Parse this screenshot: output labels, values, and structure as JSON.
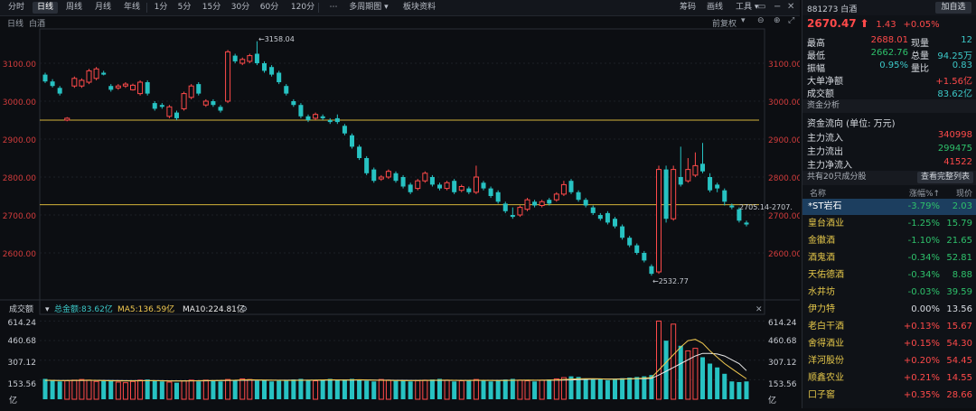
{
  "toolbar": {
    "items": [
      "分时",
      "日线",
      "周线",
      "月线",
      "年线",
      "1分",
      "5分",
      "15分",
      "30分",
      "60分",
      "120分",
      "多周期图",
      "板块资料"
    ],
    "right": [
      "筹码",
      "画线",
      "工具"
    ]
  },
  "subbar": {
    "period": "日线",
    "name": "白酒",
    "fq": "前复权"
  },
  "chart": {
    "price_axis": [
      "3100.00",
      "3000.00",
      "2900.00",
      "2800.00",
      "2700.00",
      "2600.00"
    ],
    "vol_axis": [
      "614.24",
      "460.68",
      "307.12",
      "153.56",
      "亿"
    ],
    "annot_high": "←3158.04",
    "annot_low": "←2532.77",
    "annot_line": "2705.14-2707.",
    "vol_legend": {
      "title": "成交额",
      "total": "总金额:83.62亿",
      "ma5": "MA5:136.59亿",
      "ma10": "MA10:224.81亿"
    },
    "colors": {
      "up": "#ff4a4a",
      "down": "#27c2c2",
      "ma5": "#f0c850",
      "ma10": "#e8e8e8",
      "hline": "#d4b43a"
    }
  },
  "chart_data": {
    "type": "candlestick",
    "y_range": [
      2505,
      3195
    ],
    "hlines": [
      2950,
      2727
    ],
    "candles": [
      [
        3070,
        3052,
        3075,
        3048
      ],
      [
        3052,
        3040,
        3058,
        3036
      ],
      [
        3035,
        3020,
        3040,
        3015
      ],
      [
        2950,
        2955,
        2958,
        2947
      ],
      [
        3040,
        3060,
        3065,
        3035
      ],
      [
        3040,
        3055,
        3060,
        3035
      ],
      [
        3050,
        3080,
        3085,
        3045
      ],
      [
        3060,
        3085,
        3090,
        3055
      ],
      [
        3075,
        3070,
        3080,
        3068
      ],
      [
        3040,
        3030,
        3045,
        3025
      ],
      [
        3035,
        3040,
        3045,
        3030
      ],
      [
        3040,
        3045,
        3050,
        3035
      ],
      [
        3030,
        3042,
        3046,
        3028
      ],
      [
        3020,
        3050,
        3055,
        3015
      ],
      [
        3050,
        3020,
        3055,
        3015
      ],
      [
        2995,
        2980,
        3000,
        2975
      ],
      [
        2990,
        2985,
        2995,
        2980
      ],
      [
        2960,
        2985,
        2990,
        2955
      ],
      [
        2970,
        2955,
        2975,
        2950
      ],
      [
        2980,
        3020,
        3025,
        2975
      ],
      [
        3010,
        3040,
        3045,
        3005
      ],
      [
        3045,
        3020,
        3050,
        3015
      ],
      [
        2990,
        3000,
        3005,
        2985
      ],
      [
        3000,
        2990,
        3005,
        2985
      ],
      [
        2985,
        2975,
        2990,
        2970
      ],
      [
        3000,
        3130,
        3135,
        2995
      ],
      [
        3120,
        3105,
        3125,
        3100
      ],
      [
        3100,
        3110,
        3115,
        3095
      ],
      [
        3105,
        3120,
        3125,
        3100
      ],
      [
        3125,
        3100,
        3158,
        3095
      ],
      [
        3100,
        3080,
        3105,
        3075
      ],
      [
        3090,
        3070,
        3095,
        3065
      ],
      [
        3075,
        3050,
        3080,
        3045
      ],
      [
        3040,
        3020,
        3045,
        3015
      ],
      [
        3000,
        2990,
        3005,
        2985
      ],
      [
        2990,
        2960,
        2995,
        2955
      ],
      [
        2960,
        2950,
        2965,
        2945
      ],
      [
        2955,
        2965,
        2970,
        2950
      ],
      [
        2960,
        2955,
        2965,
        2950
      ],
      [
        2950,
        2945,
        2955,
        2940
      ],
      [
        2955,
        2945,
        2965,
        2940
      ],
      [
        2935,
        2915,
        2940,
        2910
      ],
      [
        2910,
        2880,
        2915,
        2875
      ],
      [
        2880,
        2850,
        2885,
        2845
      ],
      [
        2850,
        2810,
        2855,
        2805
      ],
      [
        2820,
        2790,
        2825,
        2785
      ],
      [
        2795,
        2800,
        2805,
        2790
      ],
      [
        2800,
        2815,
        2820,
        2795
      ],
      [
        2810,
        2790,
        2815,
        2785
      ],
      [
        2800,
        2775,
        2805,
        2770
      ],
      [
        2780,
        2760,
        2785,
        2755
      ],
      [
        2770,
        2790,
        2795,
        2765
      ],
      [
        2790,
        2810,
        2815,
        2785
      ],
      [
        2800,
        2780,
        2805,
        2775
      ],
      [
        2780,
        2770,
        2785,
        2765
      ],
      [
        2770,
        2785,
        2790,
        2765
      ],
      [
        2790,
        2760,
        2795,
        2755
      ],
      [
        2765,
        2775,
        2780,
        2760
      ],
      [
        2770,
        2760,
        2775,
        2755
      ],
      [
        2760,
        2800,
        2830,
        2755
      ],
      [
        2785,
        2770,
        2790,
        2765
      ],
      [
        2770,
        2750,
        2775,
        2745
      ],
      [
        2760,
        2735,
        2765,
        2730
      ],
      [
        2730,
        2710,
        2735,
        2705
      ],
      [
        2700,
        2695,
        2720,
        2690
      ],
      [
        2700,
        2720,
        2725,
        2695
      ],
      [
        2715,
        2740,
        2745,
        2710
      ],
      [
        2735,
        2725,
        2740,
        2720
      ],
      [
        2725,
        2735,
        2740,
        2720
      ],
      [
        2740,
        2730,
        2745,
        2725
      ],
      [
        2740,
        2755,
        2760,
        2735
      ],
      [
        2755,
        2780,
        2790,
        2750
      ],
      [
        2790,
        2760,
        2795,
        2755
      ],
      [
        2760,
        2740,
        2765,
        2735
      ],
      [
        2740,
        2725,
        2745,
        2720
      ],
      [
        2720,
        2705,
        2725,
        2700
      ],
      [
        2700,
        2690,
        2705,
        2685
      ],
      [
        2705,
        2680,
        2710,
        2675
      ],
      [
        2690,
        2670,
        2695,
        2665
      ],
      [
        2670,
        2640,
        2675,
        2635
      ],
      [
        2640,
        2620,
        2645,
        2615
      ],
      [
        2620,
        2600,
        2625,
        2595
      ],
      [
        2600,
        2580,
        2605,
        2575
      ],
      [
        2565,
        2545,
        2570,
        2540
      ],
      [
        2550,
        2820,
        2830,
        2545
      ],
      [
        2820,
        2690,
        2830,
        2680
      ],
      [
        2690,
        2820,
        2830,
        2685
      ],
      [
        2800,
        2780,
        2880,
        2775
      ],
      [
        2790,
        2820,
        2850,
        2785
      ],
      [
        2805,
        2830,
        2865,
        2800
      ],
      [
        2835,
        2815,
        2890,
        2810
      ],
      [
        2800,
        2765,
        2810,
        2760
      ],
      [
        2780,
        2770,
        2785,
        2760
      ],
      [
        2765,
        2735,
        2770,
        2725
      ],
      [
        2725,
        2720,
        2730,
        2715
      ],
      [
        2715,
        2685,
        2720,
        2680
      ],
      [
        2680,
        2675,
        2685,
        2670
      ]
    ],
    "volume": {
      "series": [
        {
          "name": "成交额",
          "unit": "亿",
          "values": [
            160,
            150,
            140,
            145,
            150,
            155,
            150,
            140,
            145,
            150,
            135,
            130,
            140,
            150,
            155,
            145,
            140,
            135,
            130,
            145,
            150,
            140,
            150,
            145,
            140,
            155,
            150,
            160,
            155,
            145,
            150,
            140,
            145,
            150,
            155,
            160,
            150,
            145,
            150,
            160,
            150,
            155,
            160,
            150,
            145,
            140,
            155,
            150,
            145,
            150,
            140,
            145,
            150,
            155,
            160,
            150,
            140,
            145,
            150,
            155,
            145,
            140,
            150,
            155,
            160,
            150,
            145,
            140,
            150,
            155,
            160,
            170,
            180,
            175,
            160,
            155,
            160,
            150,
            155,
            165,
            170,
            175,
            180,
            190,
            614,
            460,
            590,
            420,
            380,
            400,
            330,
            280,
            250,
            200,
            140,
            135,
            140
          ]
        },
        {
          "name": "MA5",
          "values": [
            150,
            148,
            146,
            147,
            148,
            149,
            150,
            148,
            146,
            145,
            145,
            144,
            145,
            145,
            146,
            146,
            145,
            144,
            143,
            144,
            145,
            146,
            147,
            147,
            148,
            149,
            150,
            152,
            153,
            152,
            151,
            150,
            149,
            148,
            148,
            149,
            150,
            151,
            152,
            153,
            152,
            151,
            152,
            153,
            152,
            150,
            149,
            148,
            147,
            146,
            146,
            147,
            148,
            149,
            150,
            150,
            149,
            148,
            148,
            149,
            149,
            148,
            147,
            148,
            149,
            150,
            151,
            150,
            150,
            151,
            152,
            155,
            158,
            160,
            162,
            161,
            160,
            158,
            157,
            158,
            160,
            163,
            166,
            170,
            230,
            290,
            350,
            410,
            460,
            470,
            440,
            380,
            330,
            280,
            240,
            200,
            160
          ]
        },
        {
          "name": "MA10",
          "values": [
            148,
            148,
            147,
            147,
            147,
            147,
            148,
            148,
            148,
            147,
            147,
            146,
            146,
            146,
            146,
            146,
            146,
            145,
            145,
            145,
            145,
            145,
            145,
            146,
            146,
            147,
            148,
            149,
            150,
            150,
            150,
            150,
            150,
            150,
            150,
            150,
            150,
            150,
            150,
            151,
            151,
            151,
            151,
            151,
            151,
            151,
            150,
            150,
            149,
            149,
            148,
            148,
            148,
            148,
            148,
            148,
            148,
            148,
            148,
            148,
            148,
            148,
            148,
            148,
            149,
            149,
            149,
            149,
            149,
            150,
            150,
            151,
            152,
            154,
            156,
            158,
            159,
            159,
            159,
            160,
            160,
            161,
            162,
            164,
            190,
            220,
            250,
            280,
            310,
            340,
            360,
            360,
            355,
            340,
            310,
            280,
            225
          ]
        }
      ]
    }
  },
  "panel": {
    "code": "881273",
    "name": "白酒",
    "add": "加自选",
    "price": "2670.47",
    "arrow": "⬆",
    "change": "1.43",
    "pct": "+0.05%",
    "quotes": [
      {
        "l1": "最高",
        "v1": "2688.01",
        "c1": "red",
        "l2": "现量",
        "v2": "12",
        "c2": "cyan"
      },
      {
        "l1": "最低",
        "v1": "2662.76",
        "c1": "green",
        "l2": "总量",
        "v2": "94.25万",
        "c2": "cyan"
      },
      {
        "l1": "振幅",
        "v1": "0.95%",
        "c1": "cyan",
        "l2": "量比",
        "v2": "0.83",
        "c2": "cyan"
      },
      {
        "l1": "大单净额",
        "v1": "+1.56亿",
        "c1": "red",
        "l2": "",
        "v2": "",
        "c2": "white"
      },
      {
        "l1": "成交额",
        "v1": "83.62亿",
        "c1": "cyan",
        "l2": "",
        "v2": "",
        "c2": "white"
      }
    ],
    "fund_title": "资金分析",
    "fund_unit": "资金流向 (单位: 万元)",
    "fund": [
      {
        "label": "主力流入",
        "value": "340998",
        "color": "red"
      },
      {
        "label": "主力流出",
        "value": "299475",
        "color": "green"
      },
      {
        "label": "主力净流入",
        "value": "41522",
        "color": "red"
      }
    ],
    "list_summary": "共有20只成分股",
    "list_btn": "查看完整列表",
    "list_head": [
      "名称",
      "涨幅%↑",
      "现价"
    ],
    "list": [
      {
        "name": "*ST岩石",
        "pct": "-3.79%",
        "price": "2.03",
        "color": "green",
        "sel": true
      },
      {
        "name": "皇台酒业",
        "pct": "-1.25%",
        "price": "15.79",
        "color": "green"
      },
      {
        "name": "金徽酒",
        "pct": "-1.10%",
        "price": "21.65",
        "color": "green"
      },
      {
        "name": "酒鬼酒",
        "pct": "-0.34%",
        "price": "52.81",
        "color": "green"
      },
      {
        "name": "天佑德酒",
        "pct": "-0.34%",
        "price": "8.88",
        "color": "green"
      },
      {
        "name": "水井坊",
        "pct": "-0.03%",
        "price": "39.59",
        "color": "green"
      },
      {
        "name": "伊力特",
        "pct": "0.00%",
        "price": "13.56",
        "color": "white"
      },
      {
        "name": "老白干酒",
        "pct": "+0.13%",
        "price": "15.67",
        "color": "red"
      },
      {
        "name": "舍得酒业",
        "pct": "+0.15%",
        "price": "54.30",
        "color": "red"
      },
      {
        "name": "洋河股份",
        "pct": "+0.20%",
        "price": "54.45",
        "color": "red"
      },
      {
        "name": "顺鑫农业",
        "pct": "+0.21%",
        "price": "14.55",
        "color": "red"
      },
      {
        "name": "口子窖",
        "pct": "+0.35%",
        "price": "28.66",
        "color": "red"
      }
    ]
  }
}
